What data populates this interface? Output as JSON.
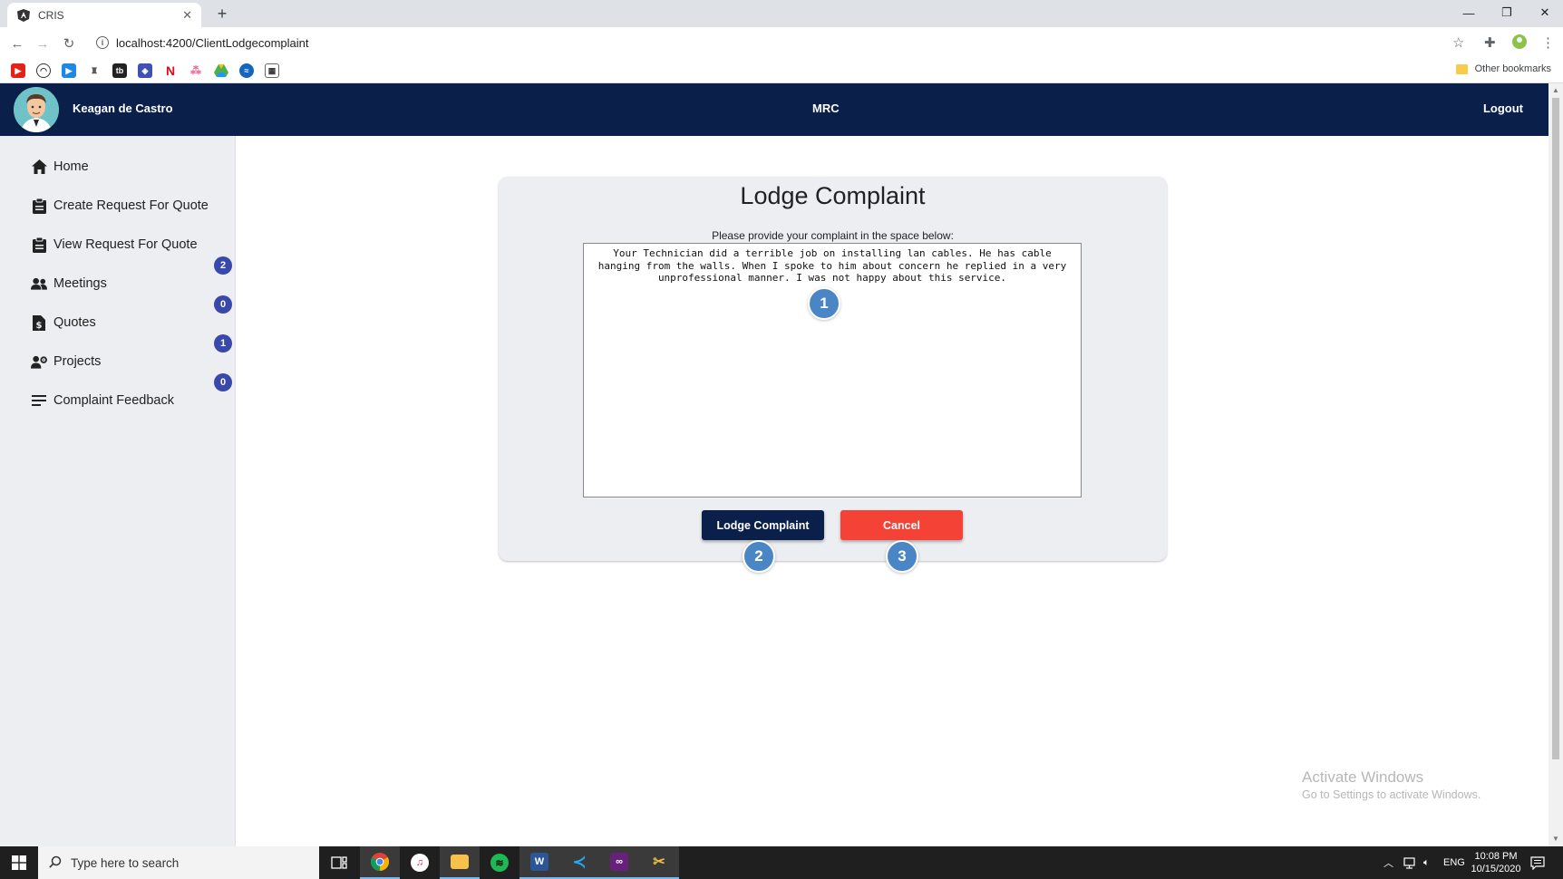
{
  "browser": {
    "tab_title": "CRIS",
    "tab_close": "✕",
    "new_tab": "+",
    "url": "localhost:4200/ClientLodgecomplaint",
    "other_bookmarks": "Other bookmarks",
    "window_controls": {
      "minimize": "—",
      "restore": "❐",
      "close": "✕"
    }
  },
  "header": {
    "user_name": "Keagan de Castro",
    "brand": "MRC",
    "logout": "Logout"
  },
  "sidebar": {
    "items": [
      {
        "label": "Home",
        "icon": "home-icon"
      },
      {
        "label": "Create Request For Quote",
        "icon": "clipboard-icon"
      },
      {
        "label": "View Request For Quote",
        "icon": "clipboard-icon"
      },
      {
        "label": "Meetings",
        "icon": "people-icon"
      },
      {
        "label": "Quotes",
        "icon": "dollar-document-icon"
      },
      {
        "label": "Projects",
        "icon": "user-gear-icon"
      },
      {
        "label": "Complaint Feedback",
        "icon": "lines-icon"
      }
    ],
    "badges": [
      "2",
      "0",
      "1",
      "0"
    ]
  },
  "form": {
    "title": "Lodge Complaint",
    "instruction": "Please provide your complaint in the space below:",
    "complaint_text": "Your Technician did a terrible job on installing lan cables. He has cable hanging from the walls. When I spoke to him about concern he replied in a very unprofessional manner. I was not happy about this service.",
    "lodge_button": "Lodge Complaint",
    "cancel_button": "Cancel"
  },
  "markers": [
    "1",
    "2",
    "3"
  ],
  "watermark": {
    "title": "Activate Windows",
    "subtitle": "Go to Settings to activate Windows."
  },
  "taskbar": {
    "search_placeholder": "Type here to search",
    "language": "ENG",
    "time": "10:08 PM",
    "date": "10/15/2020"
  },
  "colors": {
    "header_bg": "#0b1f4b",
    "primary_button": "#0b1f4b",
    "cancel_button": "#f44336",
    "badge": "#3949ab",
    "marker": "#4a86c5",
    "sidebar_bg": "#eceef2"
  }
}
